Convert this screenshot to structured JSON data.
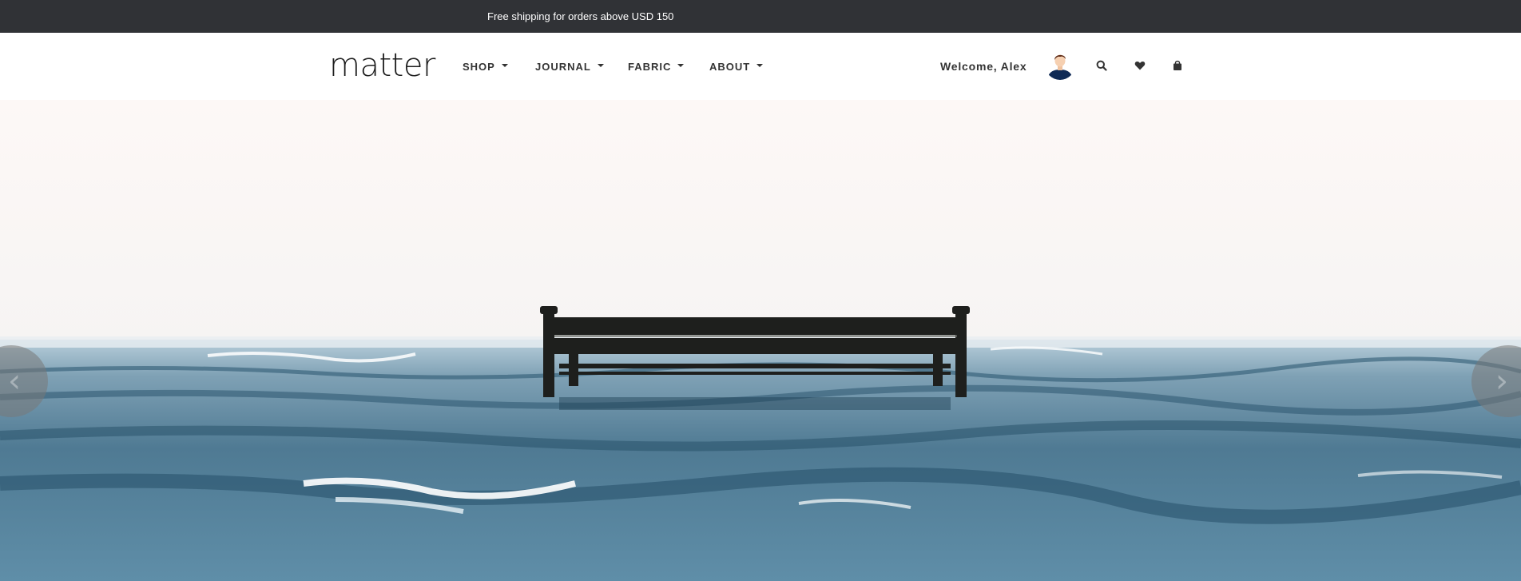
{
  "announcement": {
    "text": "Free shipping for orders above USD 150"
  },
  "header": {
    "logo": "matter",
    "nav": [
      {
        "label": "SHOP"
      },
      {
        "label": "JOURNAL"
      },
      {
        "label": "FABRIC"
      },
      {
        "label": "ABOUT"
      }
    ],
    "welcome": "Welcome, Alex",
    "icons": [
      "user-avatar",
      "search-icon",
      "heart-icon",
      "shopping-bag-icon"
    ]
  },
  "carousel": {
    "prev_icon": "chevron-left-icon",
    "next_icon": "chevron-right-icon",
    "prev_glyph": "‹",
    "next_glyph": "›"
  },
  "colors": {
    "topbar_bg": "#303236",
    "sky": "#fdf8f6",
    "sea_dark": "#2f5a73",
    "sea_light": "#8fb3c6"
  }
}
